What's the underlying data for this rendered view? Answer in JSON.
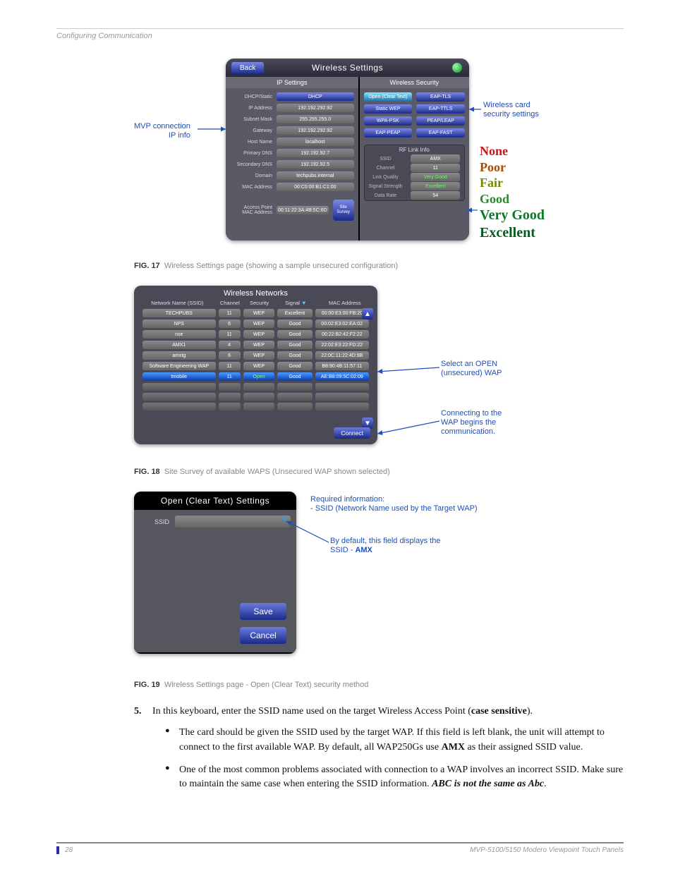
{
  "page": {
    "running_head": "Configuring Communication",
    "number": "28",
    "footer_title": "MVP-5100/5150 Modero Viewpoint  Touch Panels"
  },
  "fig17": {
    "caption_label": "FIG. 17",
    "caption_text": "Wireless Settings page (showing a sample unsecured configuration)",
    "callout_ip_line1": "MVP connection",
    "callout_ip_line2": "IP info",
    "callout_sec_line1": "Wireless card",
    "callout_sec_line2": "security settings",
    "title": "Wireless Settings",
    "back": "Back",
    "ip_section": "IP Settings",
    "sec_section": "Wireless Security",
    "ip_labels": {
      "dhcp": "DHCP/Static",
      "dhcp_val": "DHCP",
      "ip": "IP Address",
      "ip_val": "192.192.292.92",
      "mask": "Subnet Mask",
      "mask_val": "255.255.255.0",
      "gw": "Gateway",
      "gw_val": "192.192.292.92",
      "host": "Host Name",
      "host_val": "localhost",
      "pdns": "Primary DNS",
      "pdns_val": "192.192.92.7",
      "sdns": "Secondary DNS",
      "sdns_val": "192.192.92.5",
      "domain": "Domain",
      "domain_val": "techpubs.internal",
      "mac": "MAC Address",
      "mac_val": "00:C0:00:B1:C1:00",
      "ap": "Access Point\nMAC Address",
      "ap_val": "00:11:22:3A:4B:5C:6D"
    },
    "survey": "Site\nSurvey",
    "sec_buttons": [
      "Open (Clear Text)",
      "EAP-TLS",
      "Static WEP",
      "EAP-TTLS",
      "WPA-PSK",
      "PEAP/LEAP",
      "EAP-PEAP",
      "EAP-FAST"
    ],
    "rf": {
      "head": "RF Link Info",
      "ssid_k": "SSID",
      "ssid_v": "AMX",
      "ch_k": "Channel",
      "ch_v": "11",
      "lq_k": "Link Quality",
      "lq_v": "Very Good",
      "ss_k": "Signal Strength",
      "ss_v": "Excellent",
      "dr_k": "Data Rate",
      "dr_v": "54"
    },
    "scale": [
      "None",
      "Poor",
      "Fair",
      "Good",
      "Very Good",
      "Excellent"
    ]
  },
  "fig18": {
    "caption_label": "FIG. 18",
    "caption_text": "Site Survey of available WAPS (Unsecured WAP shown selected)",
    "title": "Wireless Networks",
    "headers": {
      "ssid": "Network Name (SSID)",
      "ch": "Channel",
      "sec": "Security",
      "sig": "Signal",
      "mac": "MAC Address"
    },
    "rows": [
      {
        "ssid": "TECHPUBS",
        "ch": "11",
        "sec": "WEP",
        "sig": "Excellent",
        "mac": "00:00:E3:00:FB:20"
      },
      {
        "ssid": "NPS",
        "ch": "6",
        "sec": "WEP",
        "sig": "Good",
        "mac": "00:02:E3:02:EA:02"
      },
      {
        "ssid": "nse",
        "ch": "11",
        "sec": "WEP",
        "sig": "Good",
        "mac": "00:22:B2:42:F2:22"
      },
      {
        "ssid": "AMX1",
        "ch": "4",
        "sec": "WEP",
        "sig": "Good",
        "mac": "22:02:E3:22:FD:22"
      },
      {
        "ssid": "amxtg",
        "ch": "6",
        "sec": "WEP",
        "sig": "Good",
        "mac": "22:0C:11:22:4D:9B"
      },
      {
        "ssid": "Software Engineering WAP",
        "ch": "11",
        "sec": "WEP",
        "sig": "Good",
        "mac": "B8:90:4B:11:57:11"
      },
      {
        "ssid": "tmobile",
        "ch": "11",
        "sec": "Open",
        "sig": "Good",
        "mac": "AE:B8:09:5C:02:09",
        "selected": true
      }
    ],
    "connect": "Connect",
    "callout_a1": "Select an OPEN",
    "callout_a2": "(unsecured) WAP",
    "callout_b1": "Connecting to the",
    "callout_b2": "WAP begins the",
    "callout_b3": "communication."
  },
  "fig19": {
    "caption_label": "FIG. 19",
    "caption_text": "Wireless Settings page - Open (Clear Text) security method",
    "title": "Open (Clear Text) Settings",
    "ssid_label": "SSID",
    "save": "Save",
    "cancel": "Cancel",
    "call_a1": "Required information:",
    "call_a2": "- SSID (Network Name used by the Target WAP)",
    "call_b1": "By default, this field displays the",
    "call_b2a": "SSID - ",
    "call_b2b": "AMX"
  },
  "body": {
    "step_num": "5.",
    "step_text_a": "In this keyboard, enter the SSID name used on the target Wireless Access Point (",
    "step_text_b": "case sensitive",
    "step_text_c": ").",
    "bullet1_a": "The card should be given the SSID used by the target WAP. If this field is left blank, the unit will attempt to connect to the first available WAP. By default, all WAP250Gs use ",
    "bullet1_b": "AMX",
    "bullet1_c": " as their assigned SSID value.",
    "bullet2_a": "One of the most common problems associated with connection to a WAP involves an incorrect SSID. Make sure to maintain the same case when entering the SSID information. ",
    "bullet2_b": "ABC is not the same as Abc",
    "bullet2_c": "."
  }
}
